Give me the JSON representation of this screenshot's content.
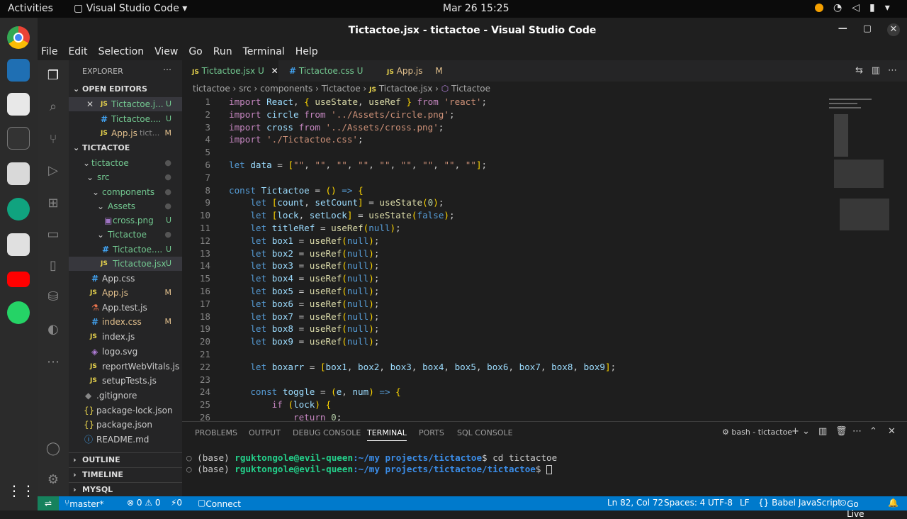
{
  "os": {
    "activities": "Activities",
    "app_menu": "Visual Studio Code ▾",
    "clock": "Mar 26  15:25"
  },
  "window": {
    "title": "Tictactoe.jsx - tictactoe - Visual Studio Code"
  },
  "menu": [
    "File",
    "Edit",
    "Selection",
    "View",
    "Go",
    "Run",
    "Terminal",
    "Help"
  ],
  "explorer": {
    "title": "EXPLORER",
    "open_editors_label": "OPEN EDITORS",
    "open_editors": [
      {
        "name": "Tictactoe.j...",
        "status": "U"
      },
      {
        "name": "Tictactoe....",
        "status": "U"
      },
      {
        "name": "App.js",
        "hint": "tict...",
        "status": "M"
      }
    ],
    "project_label": "TICTACTOE",
    "tree": [
      {
        "name": "tictactoe",
        "status": "●"
      },
      {
        "name": "src",
        "status": "●"
      },
      {
        "name": "components",
        "status": "●"
      },
      {
        "name": "Assets",
        "status": "●"
      },
      {
        "name": "cross.png",
        "status": "U"
      },
      {
        "name": "Tictactoe",
        "status": "●"
      },
      {
        "name": "Tictactoe....",
        "status": "U"
      },
      {
        "name": "Tictactoe.jsx",
        "status": "U"
      },
      {
        "name": "App.css",
        "status": ""
      },
      {
        "name": "App.js",
        "status": "M"
      },
      {
        "name": "App.test.js",
        "status": ""
      },
      {
        "name": "index.css",
        "status": "M"
      },
      {
        "name": "index.js",
        "status": ""
      },
      {
        "name": "logo.svg",
        "status": ""
      },
      {
        "name": "reportWebVitals.js",
        "status": ""
      },
      {
        "name": "setupTests.js",
        "status": ""
      },
      {
        "name": ".gitignore",
        "status": ""
      },
      {
        "name": "package-lock.json",
        "status": ""
      },
      {
        "name": "package.json",
        "status": ""
      },
      {
        "name": "README.md",
        "status": ""
      }
    ],
    "outline": "OUTLINE",
    "timeline": "TIMELINE",
    "mysql": "MYSQL"
  },
  "tabs": [
    {
      "name": "Tictactoe.jsx",
      "status": "U"
    },
    {
      "name": "Tictactoe.css",
      "status": "U"
    },
    {
      "name": "App.js",
      "status": "M"
    }
  ],
  "breadcrumb": [
    "tictactoe",
    "src",
    "components",
    "Tictactoe",
    "Tictactoe.jsx",
    "Tictactoe"
  ],
  "code_lines": [
    "import React, { useState, useRef } from 'react';",
    "import circle from '../Assets/circle.png';",
    "import cross from '../Assets/cross.png';",
    "import './Tictactoe.css';",
    "",
    "let data = [\"\", \"\", \"\", \"\", \"\", \"\", \"\", \"\", \"\"];",
    "",
    "const Tictactoe = () => {",
    "    let [count, setCount] = useState(0);",
    "    let [lock, setLock] = useState(false);",
    "    let titleRef = useRef(null);",
    "    let box1 = useRef(null);",
    "    let box2 = useRef(null);",
    "    let box3 = useRef(null);",
    "    let box4 = useRef(null);",
    "    let box5 = useRef(null);",
    "    let box6 = useRef(null);",
    "    let box7 = useRef(null);",
    "    let box8 = useRef(null);",
    "    let box9 = useRef(null);",
    "",
    "    let boxarr = [box1, box2, box3, box4, box5, box6, box7, box8, box9];",
    "",
    "    const toggle = (e, num) => {",
    "        if (lock) {",
    "            return 0;"
  ],
  "panel": {
    "tabs": [
      "PROBLEMS",
      "OUTPUT",
      "DEBUG CONSOLE",
      "TERMINAL",
      "PORTS",
      "SQL CONSOLE"
    ],
    "active_tab": "TERMINAL",
    "shell": "bash - tictactoe",
    "lines": [
      {
        "env": "(base) ",
        "user": "rguktongole@evil-queen",
        "path": ":~/my projects/tictactoe",
        "cmd": "$ cd tictactoe"
      },
      {
        "env": "(base) ",
        "user": "rguktongole@evil-queen",
        "path": ":~/my projects/tictactoe/tictactoe",
        "cmd": "$ "
      }
    ]
  },
  "status": {
    "branch": "master*",
    "errors": "⊗ 0 ⚠ 0",
    "ports": "⚡0",
    "connect": "Connect",
    "position": "Ln 82, Col 72",
    "spaces": "Spaces: 4",
    "encoding": "UTF-8",
    "eol": "LF",
    "language": "{} Babel JavaScript",
    "golive": "Go Live"
  },
  "colors": {
    "accent": "#007acc",
    "untracked": "#73c991",
    "modified": "#e2c08d"
  }
}
